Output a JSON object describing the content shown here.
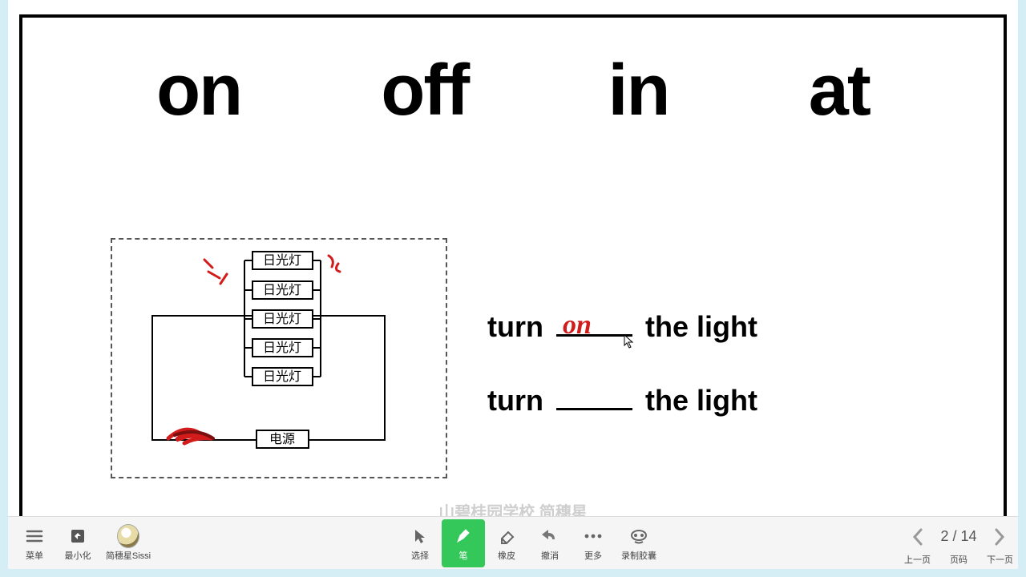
{
  "wordbank": [
    "on",
    "off",
    "in",
    "at"
  ],
  "sentences": {
    "s1_pre": "turn",
    "s1_ans": "on",
    "s1_post": "the light",
    "s2_pre": "turn",
    "s2_post": "the light"
  },
  "diagram": {
    "lamp": "日光灯",
    "power": "电源"
  },
  "watermark": "山碧桂园学校  简穗星",
  "toolbar": {
    "menu": "菜单",
    "minimize": "最小化",
    "user": "简穗星Sissi",
    "select": "选择",
    "pen": "笔",
    "eraser": "橡皮",
    "undo": "撤消",
    "more": "更多",
    "record": "录制胶囊",
    "prev": "上一页",
    "page_label": "页码",
    "next": "下一页",
    "page_current": "2",
    "page_total": "14"
  }
}
